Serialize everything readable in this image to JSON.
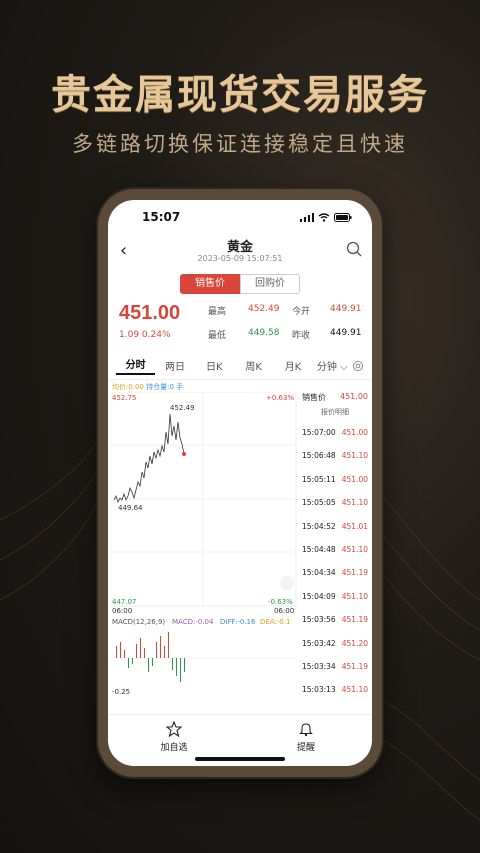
{
  "headline": "贵金属现货交易服务",
  "subline": "多链路切换保证连接稳定且快速",
  "status": {
    "time": "15:07"
  },
  "nav": {
    "title": "黄金",
    "datetime": "2023-05-09 15:07:51"
  },
  "segments": {
    "active": "销售价",
    "inactive": "回购价"
  },
  "quote": {
    "price": "451.00",
    "change": "1.09  0.24%",
    "high_label": "最高",
    "high": "452.49",
    "open_label": "今开",
    "open": "449.91",
    "low_label": "最低",
    "low": "449.58",
    "prev_label": "昨收",
    "prev": "449.91"
  },
  "tabs": [
    "分时",
    "两日",
    "日K",
    "周K",
    "月K",
    "分钟 ⌵"
  ],
  "chart_legend": {
    "avg": "均价:0.00",
    "pos": "持仓量:0 手"
  },
  "chart_labels": {
    "top_left": "452.75",
    "top_right": "+0.63%",
    "bottom_left": "447.07",
    "bottom_right": "-0.63%",
    "time_left": "06:00",
    "time_right": "06:00",
    "high_mark": "452.49",
    "low_mark": "449.64",
    "macd": "MACD(12,26,9)",
    "macd_val": "MACD:-0.04",
    "diff": "DIFF:-0.16",
    "dea": "DEA:-0.1",
    "macd_bottom": "-0.25"
  },
  "ticks": {
    "header_label": "销售价",
    "header_value": "451.00",
    "sub": "报价明细",
    "rows": [
      {
        "t": "15:07:00",
        "p": "451.00"
      },
      {
        "t": "15:06:48",
        "p": "451.10"
      },
      {
        "t": "15:05:11",
        "p": "451.00"
      },
      {
        "t": "15:05:05",
        "p": "451.10"
      },
      {
        "t": "15:04:52",
        "p": "451.01"
      },
      {
        "t": "15:04:48",
        "p": "451.10"
      },
      {
        "t": "15:04:34",
        "p": "451.19"
      },
      {
        "t": "15:04:09",
        "p": "451.10"
      },
      {
        "t": "15:03:56",
        "p": "451.19"
      },
      {
        "t": "15:03:42",
        "p": "451.20"
      },
      {
        "t": "15:03:34",
        "p": "451.19"
      },
      {
        "t": "15:03:13",
        "p": "451.10"
      }
    ]
  },
  "bottom": {
    "fav": "加自选",
    "alert": "提醒"
  },
  "colors": {
    "accent": "#d9453a",
    "gold": "#e6c79a"
  }
}
